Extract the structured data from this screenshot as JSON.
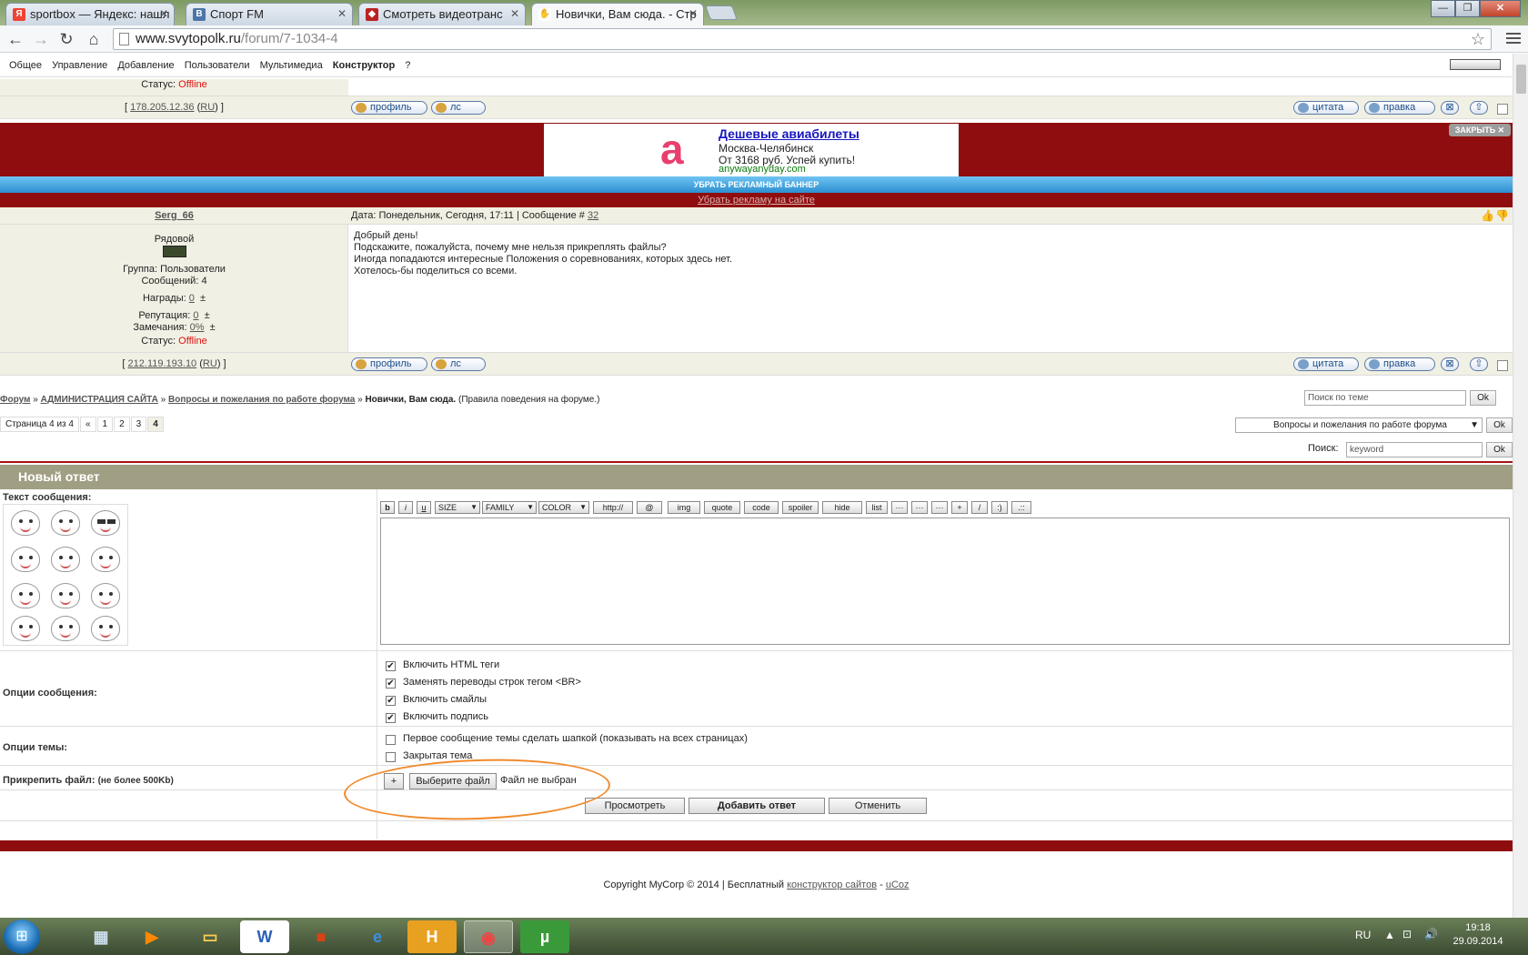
{
  "browser": {
    "tabs": [
      {
        "title": "sportbox — Яндекс: нашл",
        "favicon": "Я",
        "active": false
      },
      {
        "title": "Спорт FM",
        "favicon": "B",
        "active": false
      },
      {
        "title": "Смотреть видеотранс",
        "favicon": "◆",
        "active": false
      },
      {
        "title": "Новички, Вам сюда. - Стр",
        "favicon": "✋",
        "active": true
      }
    ],
    "url_host": "www.svytopolk.ru",
    "url_path": "/forum/7-1034-4",
    "window_buttons": [
      "—",
      "❐",
      "✕"
    ]
  },
  "adminbar": {
    "items": [
      "Общее",
      "Управление",
      "Добавление",
      "Пользователи",
      "Мультимедиа"
    ],
    "active_item": "Конструктор",
    "help": "?"
  },
  "prev_post": {
    "status_label": "Статус:",
    "status_value": "Offline",
    "ip": "178.205.12.36",
    "country": "RU",
    "btn_profile": "профиль",
    "btn_pm": "лс",
    "btn_quote": "цитата",
    "btn_edit": "правка",
    "btn_del": "⊠",
    "btn_up": "⇧"
  },
  "ad": {
    "title": "Дешевые авиабилеты",
    "line1": "Москва-Челябинск",
    "line2": "От 3168 руб. Успей купить!",
    "url": "anywayanyday.com",
    "close": "ЗАКРЫТЬ ✕",
    "remove_banner": "УБРАТЬ РЕКЛАМНЫЙ БАННЕР",
    "remove_ads": "Убрать рекламу на сайте"
  },
  "post": {
    "author": "Serg_66",
    "date_label": "Дата: Понедельник, Сегодня, 17:11 | Сообщение #",
    "msg_num": "32",
    "rank": "Рядовой",
    "group": "Группа: Пользователи",
    "messages": "Сообщений: 4",
    "awards_label": "Награды:",
    "awards_value": "0",
    "rep_label": "Репутация:",
    "rep_value": "0",
    "warn_label": "Замечания:",
    "warn_value": "0%",
    "plus": "±",
    "status_label": "Статус:",
    "status_value": "Offline",
    "ip": "212.119.193.10",
    "country": "RU",
    "text": [
      "Добрый день!",
      "Подскажите, пожалуйста, почему мне нельзя прикреплять файлы?",
      "Иногда попадаются интересные Положения о соревнованиях, которых здесь нет.",
      "Хотелось-бы поделиться со всеми."
    ]
  },
  "nav": {
    "crumb_forum": "Форум",
    "crumb_admin": "АДМИНИСТРАЦИЯ САЙТА",
    "crumb_section": "Вопросы и пожелания по работе форума",
    "crumb_topic": "Новички, Вам сюда.",
    "crumb_rules": "(Правила поведения на форуме.)",
    "sep": "»",
    "search_topic_placeholder": "Поиск по теме",
    "ok": "Ok",
    "page_label": "Страница 4 из 4",
    "pages": [
      "«",
      "1",
      "2",
      "3",
      "4"
    ],
    "forum_select": "Вопросы и пожелания по работе форума",
    "search_label": "Поиск:",
    "search_value": "keyword"
  },
  "reply": {
    "heading": "Новый ответ",
    "text_label": "Текст сообщения:",
    "toolbar": [
      "b",
      "i",
      "u",
      "SIZE",
      "FAMILY",
      "COLOR",
      "http://",
      "@",
      "img",
      "quote",
      "code",
      "spoiler",
      "hide",
      "list",
      "···",
      "···",
      "···",
      "+",
      "/",
      ":)",
      ".::"
    ],
    "options_label": "Опции сообщения:",
    "options": [
      {
        "label": "Включить HTML теги",
        "checked": true
      },
      {
        "label": "Заменять переводы строк тегом <BR>",
        "checked": true
      },
      {
        "label": "Включить смайлы",
        "checked": true
      },
      {
        "label": "Включить подпись",
        "checked": true
      }
    ],
    "topic_options_label": "Опции темы:",
    "topic_options": [
      {
        "label": "Первое сообщение темы сделать шапкой (показывать на всех страницах)",
        "checked": false
      },
      {
        "label": "Закрытая тема",
        "checked": false
      }
    ],
    "attach_label": "Прикрепить файл:",
    "attach_hint": "(не более 500Kb)",
    "add_file": "+",
    "choose_file": "Выберите файл",
    "no_file": "Файл не выбран",
    "preview": "Просмотреть",
    "submit": "Добавить ответ",
    "cancel": "Отменить"
  },
  "footer": {
    "copyright": "Copyright MyCorp © 2014 | Бесплатный",
    "link1": "конструктор сайтов",
    "dash": "-",
    "link2": "uCoz"
  },
  "taskbar": {
    "lang": "RU",
    "time": "19:18",
    "date": "29.09.2014"
  },
  "colors": {
    "ad_red": "#8f0d0e",
    "reply_header": "#a09e83",
    "highlight_ring": "#f08a2c"
  }
}
